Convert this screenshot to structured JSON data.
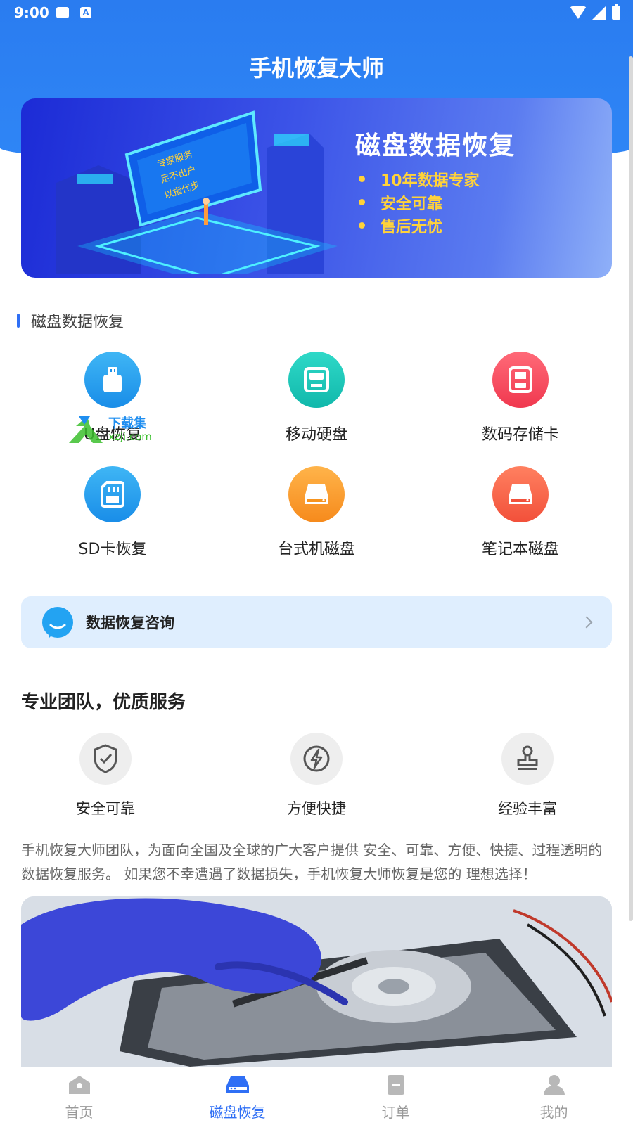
{
  "status_bar": {
    "time": "9:00",
    "icons": [
      "image-notification-icon",
      "a-notification-icon",
      "wifi-icon",
      "signal-icon",
      "battery-icon"
    ]
  },
  "header": {
    "title": "手机恢复大师"
  },
  "banner": {
    "heading": "磁盘数据恢复",
    "bullets": [
      "10年数据专家",
      "安全可靠",
      "售后无忧"
    ],
    "screen_text": [
      "专家服务",
      "足不出户",
      "以指代步"
    ]
  },
  "section": {
    "title": "磁盘数据恢复"
  },
  "categories": [
    {
      "label": "U盘恢复",
      "icon": "usb-drive-icon",
      "color": "#198de8"
    },
    {
      "label": "移动硬盘",
      "icon": "portable-disk-icon",
      "color": "#11b8ab"
    },
    {
      "label": "数码存储卡",
      "icon": "memory-card-icon",
      "color": "#f0384f"
    },
    {
      "label": "SD卡恢复",
      "icon": "sd-card-icon",
      "color": "#198de8"
    },
    {
      "label": "台式机磁盘",
      "icon": "desktop-disk-icon",
      "color": "#f68a1c"
    },
    {
      "label": "笔记本磁盘",
      "icon": "laptop-disk-icon",
      "color": "#f2503a"
    }
  ],
  "watermark": {
    "line1": "下载集",
    "line2": "xzji.com"
  },
  "consult": {
    "label": "数据恢复咨询"
  },
  "team": {
    "title": "专业团队，优质服务",
    "features": [
      {
        "label": "安全可靠",
        "icon": "shield-check-icon"
      },
      {
        "label": "方便快捷",
        "icon": "lightning-icon"
      },
      {
        "label": "经验丰富",
        "icon": "stamp-icon"
      }
    ],
    "description": "手机恢复大师团队，为面向全国及全球的广大客户提供 安全、可靠、方便、快捷、过程透明的数据恢复服务。 如果您不幸遭遇了数据损失，手机恢复大师恢复是您的 理想选择！"
  },
  "tabs": [
    {
      "label": "首页",
      "icon": "home-icon",
      "active": false
    },
    {
      "label": "磁盘恢复",
      "icon": "disk-icon",
      "active": true
    },
    {
      "label": "订单",
      "icon": "order-icon",
      "active": false
    },
    {
      "label": "我的",
      "icon": "profile-icon",
      "active": false
    }
  ],
  "colors": {
    "primary": "#2f6ff5",
    "header": "#2a7cf0",
    "consult_bg": "#dfeefe"
  }
}
